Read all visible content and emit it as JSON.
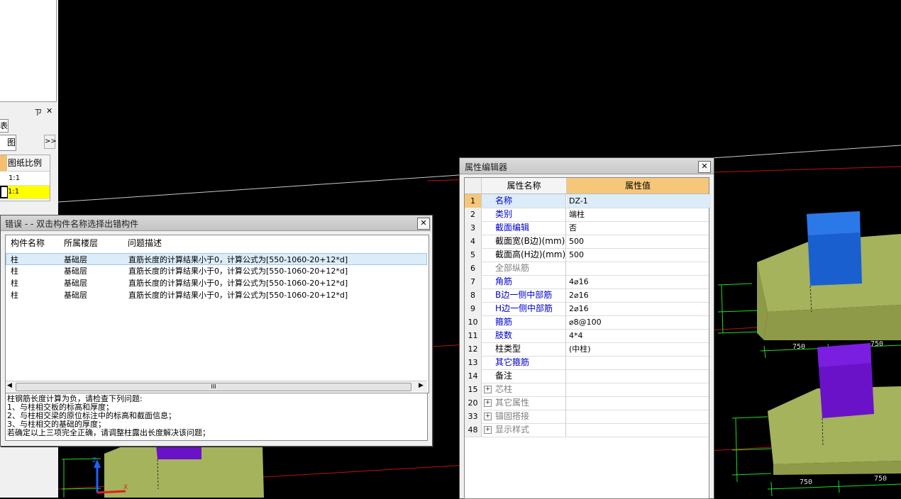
{
  "left_panel": {
    "dock_controls": {
      "pin": "ㄗ",
      "close": "✕"
    },
    "tab1": "表",
    "tab2": "图纸",
    "more": ">>",
    "grid": {
      "header": "图纸比例",
      "rows": [
        "1:1",
        "1:1"
      ]
    }
  },
  "error_dialog": {
    "title": "错误 - - 双击构件名称选择出错构件",
    "close": "✕",
    "columns": [
      "构件名称",
      "所属楼层",
      "问题描述"
    ],
    "rows": [
      {
        "name": "柱",
        "floor": "基础层",
        "desc": "直筋长度的计算结果小于0，计算公式为[550-1060-20+12*d]"
      },
      {
        "name": "柱",
        "floor": "基础层",
        "desc": "直筋长度的计算结果小于0，计算公式为[550-1060-20+12*d]"
      },
      {
        "name": "柱",
        "floor": "基础层",
        "desc": "直筋长度的计算结果小于0，计算公式为[550-1060-20+12*d]"
      },
      {
        "name": "柱",
        "floor": "基础层",
        "desc": "直筋长度的计算结果小于0，计算公式为[550-1060-20+12*d]"
      }
    ],
    "scroll_grip": "III",
    "detail_lines": [
      "柱钢筋长度计算为负，请检查下列问题:",
      "1、与柱相交板的标高和厚度；",
      "2、与柱相交梁的原位标注中的标高和截面信息；",
      "3、与柱相交的基础的厚度；",
      "若确定以上三项完全正确，请调整柱露出长度解决该问题；"
    ]
  },
  "property_editor": {
    "title": "属性编辑器",
    "close": "✕",
    "header_name": "属性名称",
    "header_value": "属性值",
    "colors": {
      "header_value_bg": "#f6c77a",
      "selected_bg": "#dcecf8",
      "blue_text": "#0000cc",
      "gray_text": "#808080"
    },
    "rows": [
      {
        "num": "1",
        "name": "名称",
        "value": "DZ-1",
        "style": "blue",
        "selected": true
      },
      {
        "num": "2",
        "name": "类别",
        "value": "端柱",
        "style": "blue"
      },
      {
        "num": "3",
        "name": "截面编辑",
        "value": "否",
        "style": "blue"
      },
      {
        "num": "4",
        "name": "截面宽(B边)(mm)",
        "value": "500",
        "style": "black"
      },
      {
        "num": "5",
        "name": "截面高(H边)(mm)",
        "value": "500",
        "style": "black"
      },
      {
        "num": "6",
        "name": "全部纵筋",
        "value": "",
        "style": "gray"
      },
      {
        "num": "7",
        "name": "角筋",
        "value": "4⌀16",
        "style": "blue"
      },
      {
        "num": "8",
        "name": "B边一侧中部筋",
        "value": "2⌀16",
        "style": "blue"
      },
      {
        "num": "9",
        "name": "H边一侧中部筋",
        "value": "2⌀16",
        "style": "blue"
      },
      {
        "num": "10",
        "name": "箍筋",
        "value": "⌀8@100",
        "style": "blue"
      },
      {
        "num": "11",
        "name": "肢数",
        "value": "4*4",
        "style": "blue"
      },
      {
        "num": "12",
        "name": "柱类型",
        "value": "(中柱)",
        "style": "black"
      },
      {
        "num": "13",
        "name": "其它箍筋",
        "value": "",
        "style": "blue"
      },
      {
        "num": "14",
        "name": "备注",
        "value": "",
        "style": "black"
      },
      {
        "num": "15",
        "name": "芯柱",
        "value": "",
        "style": "gray",
        "expand": true
      },
      {
        "num": "20",
        "name": "其它属性",
        "value": "",
        "style": "gray",
        "expand": true
      },
      {
        "num": "33",
        "name": "锚固搭接",
        "value": "",
        "style": "gray",
        "expand": true
      },
      {
        "num": "48",
        "name": "显示样式",
        "value": "",
        "style": "gray",
        "expand": true
      }
    ]
  },
  "cad": {
    "dims": [
      "750",
      "750",
      "750",
      "750",
      "750"
    ],
    "colors": {
      "footing": "#a5b35c",
      "footing_side": "#8e9a48",
      "column_blue": "#1a5fd0",
      "column_purple": "#6a12c8",
      "dim_line": "#22dd22",
      "axis_red": "#d01010"
    }
  }
}
